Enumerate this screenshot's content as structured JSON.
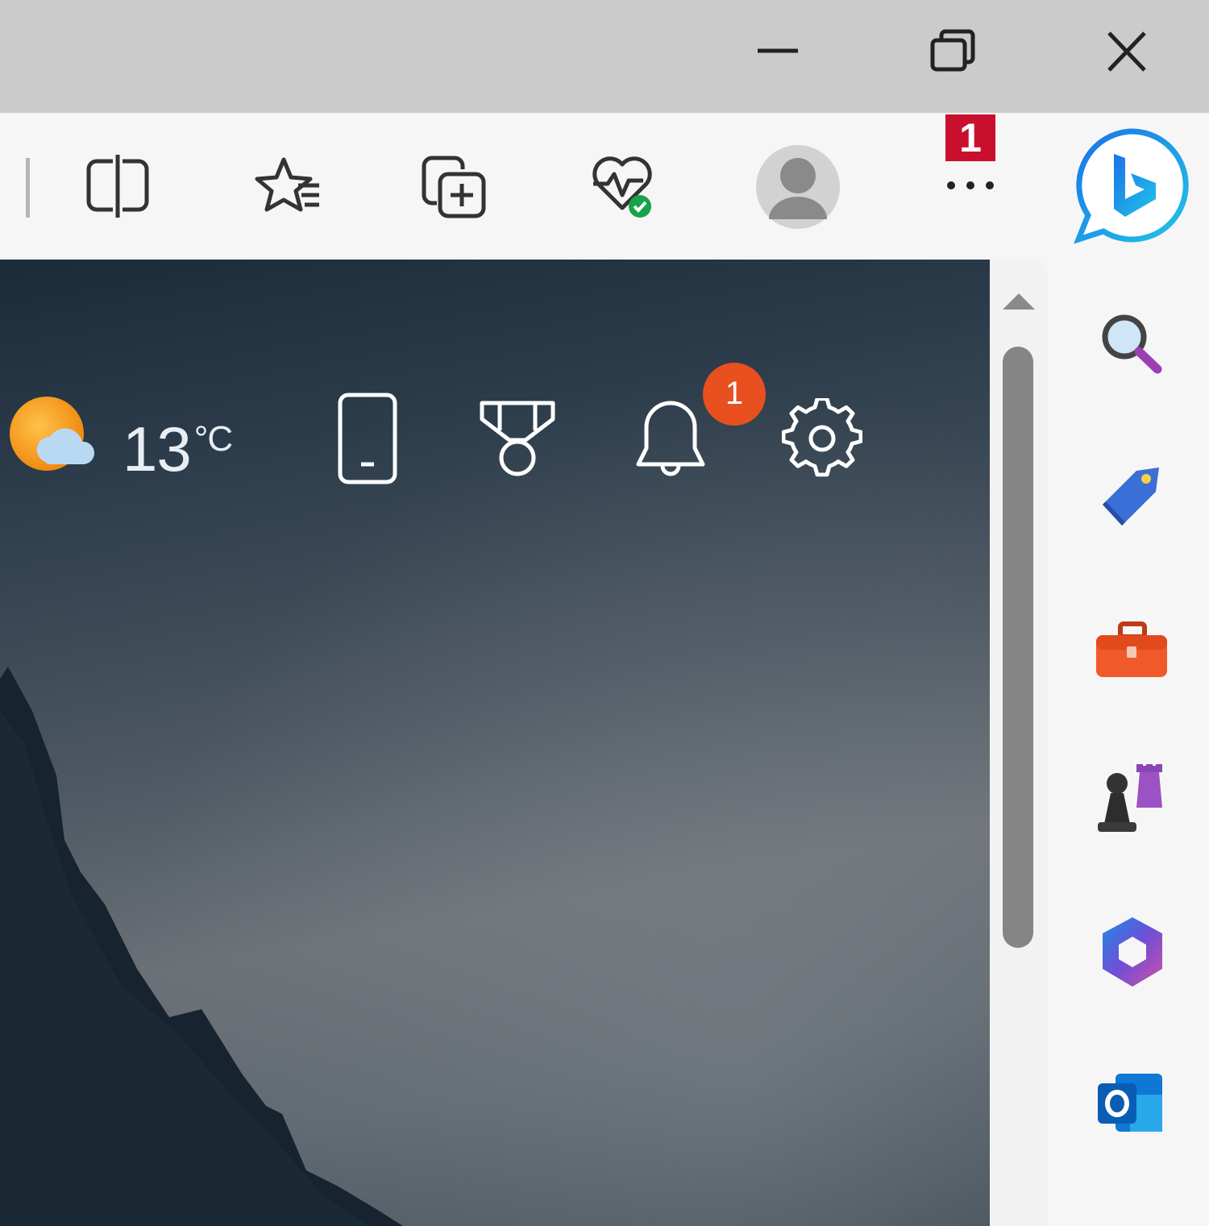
{
  "window": {
    "minimize_icon": "minimize-icon",
    "restore_icon": "restore-icon",
    "close_icon": "close-icon"
  },
  "toolbar": {
    "icons": [
      "split-screen-icon",
      "favorites-icon",
      "collections-icon",
      "browser-essentials-icon",
      "profile-avatar",
      "more-icon",
      "copilot-icon"
    ],
    "more_badge": "1"
  },
  "newtab": {
    "weather_icon": "partly-sunny-icon",
    "temperature": "13",
    "temperature_unit": "°C",
    "icons": [
      "phone-icon",
      "rewards-icon",
      "bell-icon",
      "settings-icon"
    ],
    "notification_badge": "1"
  },
  "sidebar": {
    "items": [
      "search-icon",
      "shopping-icon",
      "tools-icon",
      "games-icon",
      "microsoft-365-icon",
      "outlook-icon"
    ]
  },
  "colors": {
    "titlebar": "#cbcbcb",
    "toolbar": "#f6f6f6",
    "badge_red": "#c8102e",
    "notification_orange": "#e8501f"
  }
}
